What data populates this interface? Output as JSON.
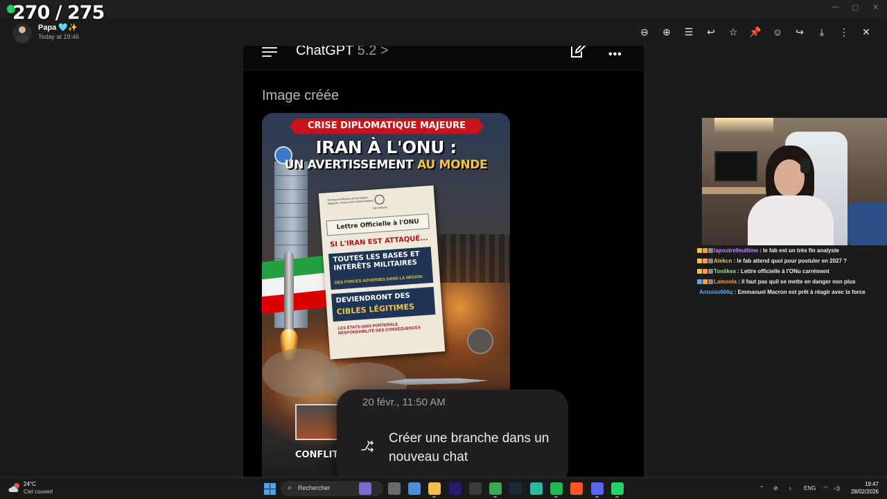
{
  "overlay": {
    "counter": "270 / 275"
  },
  "window": {
    "minimize": "—",
    "maximize": "▢",
    "close": "✕"
  },
  "message": {
    "sender_name": "Papa 🩵✨",
    "time": "Today at 19:46"
  },
  "viewer_toolbar": [
    {
      "name": "zoom-out-icon",
      "glyph": "⊖"
    },
    {
      "name": "zoom-in-icon",
      "glyph": "⊕"
    },
    {
      "name": "caption-icon",
      "glyph": "☰"
    },
    {
      "name": "reply-icon",
      "glyph": "↩"
    },
    {
      "name": "star-icon",
      "glyph": "☆"
    },
    {
      "name": "pin-icon",
      "glyph": "📌"
    },
    {
      "name": "emoji-icon",
      "glyph": "☺"
    },
    {
      "name": "forward-icon",
      "glyph": "↪"
    },
    {
      "name": "download-icon",
      "glyph": "⤓"
    },
    {
      "name": "more-vertical-icon",
      "glyph": "⋮"
    },
    {
      "name": "close-icon",
      "glyph": "✕"
    }
  ],
  "phone": {
    "app_title": "ChatGPT",
    "version": "5.2 >",
    "more": "•••",
    "image_label": "Image créée",
    "poster": {
      "banner": "CRISE DIPLOMATIQUE MAJEURE",
      "title_line1": "IRAN À L'ONU :",
      "title_line2_a": "UN AVERTISSEMENT ",
      "title_line2_b": "AU MONDE",
      "letter_header": "Permanent Mission of the Islamic Republic of Iran to the United Nations",
      "letter_emblem_text": "Iran Nations",
      "letter_title": "Lettre Officielle à l'ONU",
      "letter_red": "SI L'IRAN EST ATTAQUÉ...",
      "box1_main": "TOUTES LES BASES ET INTÉRÊTS MILITAIRES",
      "box1_sub": "DES FORCES ADVERSES DANS LA RÉGION",
      "box2_main": "DEVIENDRONT DES",
      "box2_gold": "CIBLES LÉGITIMES",
      "letter_footer": "LES ÉTATS-UNIS PORTERALE RESPONSABILITÉ DES CONSÉQUENCES",
      "bottom_text": "CONFLIT &"
    },
    "context_menu": {
      "date": "20 févr., 11:50 AM",
      "action": "Créer une branche dans un nouveau chat"
    }
  },
  "stream_chat": [
    {
      "user": "lapoutrelleultime",
      "color": "#c58af9",
      "message": "le fab est un très fin analyste"
    },
    {
      "user": "Alekcn",
      "color": "#f4c542",
      "message": "le fab attend quoi pour postuler en 2027 ?"
    },
    {
      "user": "Toniikea",
      "color": "#9ee37d",
      "message": "Lettre officielle à l'ONu carrément"
    },
    {
      "user": "Lamoola",
      "color": "#ff9f43",
      "message": "il faut pas quil se mette en danger non plus"
    },
    {
      "user": "Antonio666q",
      "color": "#5aa9ff",
      "message": "Emmanuel Macron est prêt à réagir avec la force"
    }
  ],
  "taskbar": {
    "weather_temp": "24°C",
    "weather_desc": "Ciel couvert",
    "search_placeholder": "Rechercher",
    "tray_lang": "ENG",
    "clock_time": "19:47",
    "clock_date": "28/02/2026",
    "apps": [
      {
        "name": "widgets-icon",
        "color": "#7a6ccf"
      },
      {
        "name": "task-view-icon",
        "color": "#6a6a6a"
      },
      {
        "name": "copilot-icon",
        "color": "#4a90d9"
      },
      {
        "name": "file-explorer-icon",
        "color": "#f0c14b"
      },
      {
        "name": "premiere-pro-icon",
        "color": "#2a1a6e"
      },
      {
        "name": "obs-icon",
        "color": "#3a3a3a"
      },
      {
        "name": "chrome-icon",
        "color": "#3aa757"
      },
      {
        "name": "steam-icon",
        "color": "#1b2838"
      },
      {
        "name": "streamlabs-icon",
        "color": "#2fb8a0"
      },
      {
        "name": "spotify-icon",
        "color": "#1db954"
      },
      {
        "name": "brave-icon",
        "color": "#fb542b"
      },
      {
        "name": "discord-icon",
        "color": "#5865f2"
      },
      {
        "name": "whatsapp-icon",
        "color": "#25d366"
      }
    ]
  }
}
